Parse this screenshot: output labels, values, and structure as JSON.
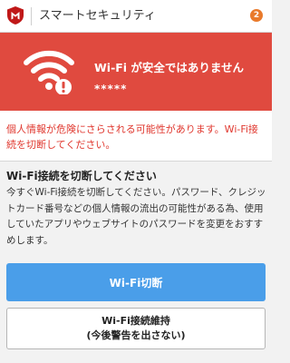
{
  "header": {
    "title": "スマートセキュリティ",
    "badge_count": "2",
    "logo_icon": "mcafee-shield-logo",
    "brand_color": "#c01818",
    "badge_color": "#e97a2b"
  },
  "alert": {
    "icon": "wifi-warning-icon",
    "title": "Wi-Fi が安全ではありません",
    "ssid": "*****",
    "background_color": "#e04a3f"
  },
  "warning": {
    "text": "個人情報が危険にさらされる可能性があります。Wi-Fi接続を切断してください。",
    "color": "#e0382f"
  },
  "info": {
    "heading": "Wi-Fi接続を切断してください",
    "body": "今すぐWi-Fi接続を切断してください。パスワード、クレジットカード番号などの個人情報の流出の可能性がある為、使用していたアプリやウェブサイトのパスワードを変更をおすすめします。"
  },
  "actions": {
    "disconnect_label": "Wi-Fi切断",
    "keep_label_line1": "Wi-Fi接続維持",
    "keep_label_line2": "(今後警告を出さない)",
    "primary_color": "#4a9ee9"
  }
}
